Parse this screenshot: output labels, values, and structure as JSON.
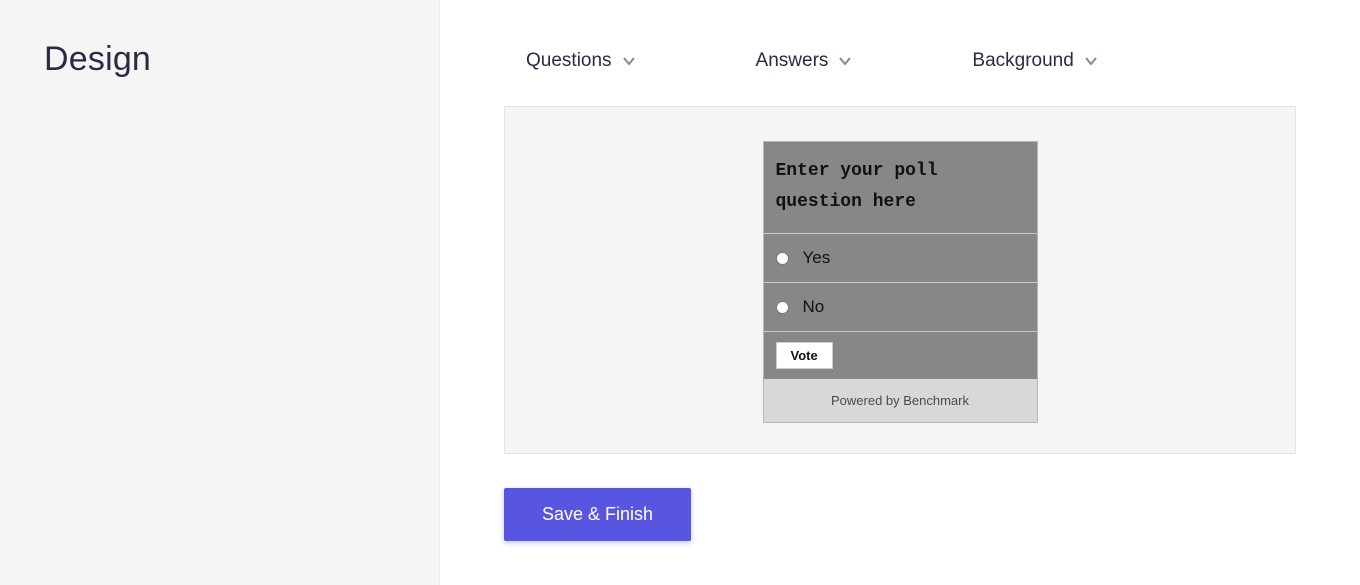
{
  "sidebar": {
    "title": "Design"
  },
  "toolbar": {
    "items": [
      {
        "label": "Questions"
      },
      {
        "label": "Answers"
      },
      {
        "label": "Background"
      }
    ]
  },
  "poll": {
    "question": "Enter your poll question here",
    "options": [
      {
        "label": "Yes"
      },
      {
        "label": "No"
      }
    ],
    "vote_label": "Vote",
    "footer": "Powered by Benchmark"
  },
  "actions": {
    "save_label": "Save & Finish"
  }
}
